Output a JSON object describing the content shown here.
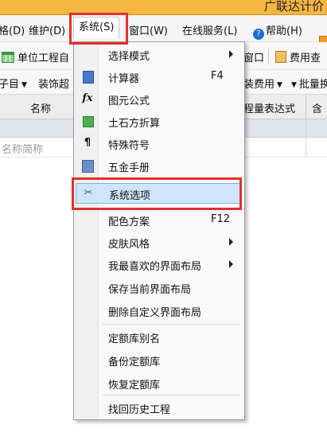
{
  "titlebar": {
    "title": "广联达计价"
  },
  "menubar": {
    "items": [
      "格(D)",
      "维护(D)",
      "系统(S)",
      "窗口(W)",
      "在线服务(L)",
      "帮助(H)"
    ],
    "help_badge": "?"
  },
  "toolbar1": {
    "unit_project": "单位工程自",
    "window_btn": "窗口",
    "fee_btn": "费用查"
  },
  "toolbar2": {
    "sub_item": "子目",
    "decoration": "装饰超",
    "fee": "装费用",
    "batch": "批量换"
  },
  "table": {
    "headers": [
      "名称",
      "程量表达式",
      "含"
    ],
    "row2_placeholder": "名称简称"
  },
  "system_menu": {
    "items": [
      {
        "label": "选择模式",
        "shortcut": "",
        "submenu": true,
        "icon": ""
      },
      {
        "label": "计算器",
        "shortcut": "F4",
        "submenu": false,
        "icon": "calculator-icon"
      },
      {
        "label": "图元公式",
        "shortcut": "",
        "submenu": false,
        "icon": "formula-icon",
        "glyph": "fx"
      },
      {
        "label": "土石方折算",
        "shortcut": "",
        "submenu": false,
        "icon": "cube-icon"
      },
      {
        "label": "特殊符号",
        "shortcut": "",
        "submenu": false,
        "icon": "pilcrow-icon",
        "glyph": "¶"
      },
      {
        "label": "五金手册",
        "shortcut": "",
        "submenu": false,
        "icon": "book-icon"
      },
      {
        "label": "系统选项",
        "shortcut": "",
        "submenu": false,
        "icon": "tools-icon",
        "glyph": "✂"
      },
      {
        "label": "配色方案",
        "shortcut": "F12",
        "submenu": false,
        "icon": ""
      },
      {
        "label": "皮肤风格",
        "shortcut": "",
        "submenu": true,
        "icon": ""
      },
      {
        "label": "我最喜欢的界面布局",
        "shortcut": "",
        "submenu": true,
        "icon": ""
      },
      {
        "label": "保存当前界面布局",
        "shortcut": "",
        "submenu": false,
        "icon": ""
      },
      {
        "label": "删除自定义界面布局",
        "shortcut": "",
        "submenu": false,
        "icon": ""
      },
      {
        "label": "定额库别名",
        "shortcut": "",
        "submenu": false,
        "icon": ""
      },
      {
        "label": "备份定额库",
        "shortcut": "",
        "submenu": false,
        "icon": ""
      },
      {
        "label": "恢复定额库",
        "shortcut": "",
        "submenu": false,
        "icon": ""
      },
      {
        "label": "找回历史工程",
        "shortcut": "",
        "submenu": false,
        "icon": ""
      }
    ]
  },
  "colors": {
    "titlebar": "#f6b642",
    "highlight": "#cfe5fb",
    "annotation": "#e2302f"
  }
}
